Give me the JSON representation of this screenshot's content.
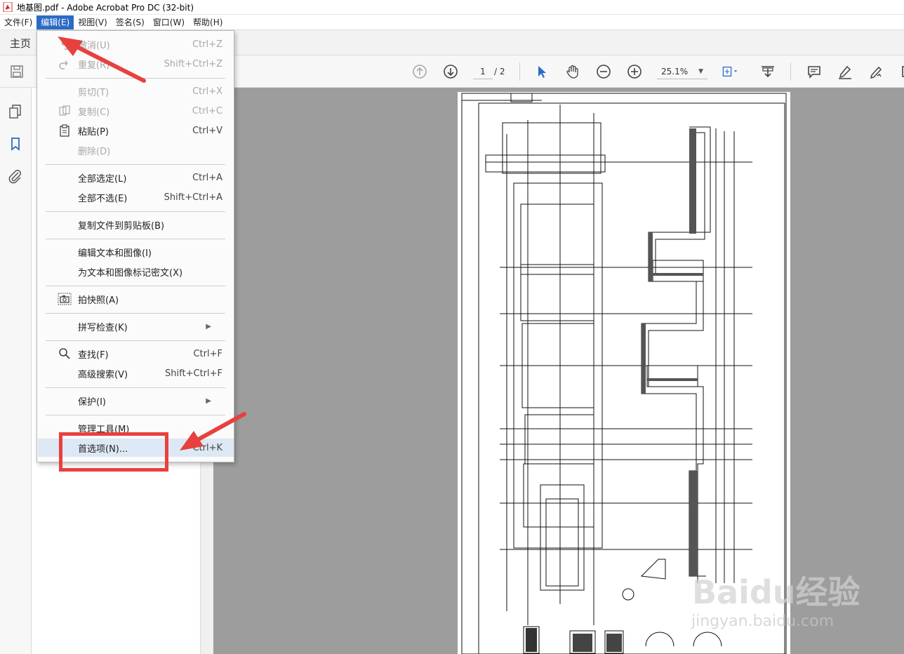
{
  "window": {
    "title": "地基图.pdf - Adobe Acrobat Pro DC (32-bit)"
  },
  "menubar": [
    {
      "label": "文件(F)",
      "active": false
    },
    {
      "label": "编辑(E)",
      "active": true
    },
    {
      "label": "视图(V)",
      "active": false
    },
    {
      "label": "签名(S)",
      "active": false
    },
    {
      "label": "窗口(W)",
      "active": false
    },
    {
      "label": "帮助(H)",
      "active": false
    }
  ],
  "tabs": {
    "home": "主页"
  },
  "toolbar": {
    "current_page": "1",
    "total_pages": "/ 2",
    "zoom": "25.1%"
  },
  "edit_menu": {
    "items": [
      {
        "label": "撤消(U)",
        "shortcut": "Ctrl+Z",
        "disabled": true,
        "icon": "undo-icon"
      },
      {
        "label": "重复(R)",
        "shortcut": "Shift+Ctrl+Z",
        "disabled": true,
        "icon": "redo-icon"
      },
      {
        "label": "剪切(T)",
        "shortcut": "Ctrl+X",
        "disabled": true,
        "icon": ""
      },
      {
        "label": "复制(C)",
        "shortcut": "Ctrl+C",
        "disabled": true,
        "icon": "copy-icon"
      },
      {
        "label": "粘贴(P)",
        "shortcut": "Ctrl+V",
        "disabled": false,
        "icon": "clipboard-icon"
      },
      {
        "label": "删除(D)",
        "shortcut": "",
        "disabled": true,
        "icon": ""
      },
      {
        "label": "全部选定(L)",
        "shortcut": "Ctrl+A",
        "disabled": false,
        "icon": ""
      },
      {
        "label": "全部不选(E)",
        "shortcut": "Shift+Ctrl+A",
        "disabled": false,
        "icon": ""
      },
      {
        "label": "复制文件到剪贴板(B)",
        "shortcut": "",
        "disabled": false,
        "icon": ""
      },
      {
        "label": "编辑文本和图像(I)",
        "shortcut": "",
        "disabled": false,
        "icon": ""
      },
      {
        "label": "为文本和图像标记密文(X)",
        "shortcut": "",
        "disabled": false,
        "icon": ""
      },
      {
        "label": "拍快照(A)",
        "shortcut": "",
        "disabled": false,
        "icon": "camera-icon"
      },
      {
        "label": "拼写检查(K)",
        "shortcut": "",
        "disabled": false,
        "icon": "",
        "submenu": true
      },
      {
        "label": "查找(F)",
        "shortcut": "Ctrl+F",
        "disabled": false,
        "icon": "search-icon"
      },
      {
        "label": "高级搜索(V)",
        "shortcut": "Shift+Ctrl+F",
        "disabled": false,
        "icon": ""
      },
      {
        "label": "保护(I)",
        "shortcut": "",
        "disabled": false,
        "icon": "",
        "submenu": true
      },
      {
        "label": "管理工具(M)",
        "shortcut": "",
        "disabled": false,
        "icon": ""
      },
      {
        "label": "首选项(N)...",
        "shortcut": "Ctrl+K",
        "disabled": false,
        "icon": "",
        "highlighted": true
      }
    ]
  },
  "watermark": {
    "brand": "Baidu经验",
    "url": "jingyan.baidu.com"
  },
  "colors": {
    "menu_active": "#2c6bc4",
    "annotation_red": "#e8403f",
    "doc_background": "#9d9d9d"
  }
}
